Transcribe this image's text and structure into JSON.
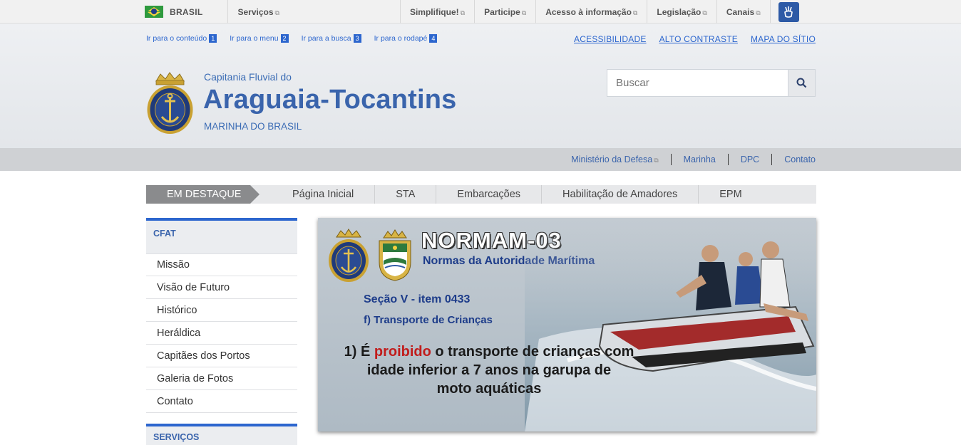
{
  "gov_bar": {
    "brasil": "BRASIL",
    "links": [
      {
        "label": "Serviços",
        "ext": "⧉"
      },
      {
        "label": "Simplifique!",
        "ext": "⧉"
      },
      {
        "label": "Participe",
        "ext": "⧉"
      },
      {
        "label": "Acesso à informação",
        "ext": "⧉"
      },
      {
        "label": "Legislação",
        "ext": "⧉"
      },
      {
        "label": "Canais",
        "ext": "⧉"
      }
    ]
  },
  "skip_links": [
    {
      "label": "Ir para o conteúdo",
      "num": "1"
    },
    {
      "label": "Ir para o menu",
      "num": "2"
    },
    {
      "label": "Ir para a busca",
      "num": "3"
    },
    {
      "label": "Ir para o rodapé",
      "num": "4"
    }
  ],
  "accessibility_links": [
    "ACESSIBILIDADE",
    "ALTO CONTRASTE",
    "MAPA DO SÍTIO"
  ],
  "site": {
    "pre_title": "Capitania Fluvial do",
    "title": "Araguaia-Tocantins",
    "subtitle": "MARINHA DO BRASIL"
  },
  "search": {
    "placeholder": "Buscar"
  },
  "service_links": [
    {
      "label": "Ministério da Defesa",
      "ext": "⧉"
    },
    {
      "label": "Marinha",
      "ext": ""
    },
    {
      "label": "DPC",
      "ext": ""
    },
    {
      "label": "Contato",
      "ext": ""
    }
  ],
  "tabs": {
    "highlight": "EM DESTAQUE",
    "items": [
      "Página Inicial",
      "STA",
      "Embarcações",
      "Habilitação de Amadores",
      "EPM"
    ]
  },
  "sidebar": {
    "section1": "CFAT",
    "items": [
      "Missão",
      "Visão de Futuro",
      "Histórico",
      "Heráldica",
      "Capitães dos Portos",
      "Galeria de Fotos",
      "Contato"
    ],
    "section2": "SERVIÇOS"
  },
  "banner": {
    "title": "NORMAM-03",
    "subtitle": "Normas da Autoridade Marítima",
    "section": "Seção V - item 0433",
    "item": "f) Transporte de Crianças",
    "text_prefix": "1) É ",
    "text_highlight": "proibido",
    "text_line1_rest": " o transporte de crianças com",
    "text_line2": "idade inferior a 7 anos na garupa de",
    "text_line3": "moto aquáticas"
  },
  "colors": {
    "accent": "#2c66ce",
    "title_blue": "#3a64ac",
    "highlight_tab": "#8a8b8d",
    "red": "#c11c1c"
  },
  "icons": [
    "brazil-flag-icon",
    "external-link-icon",
    "vlibras-icon",
    "search-icon",
    "navy-emblem-icon"
  ]
}
